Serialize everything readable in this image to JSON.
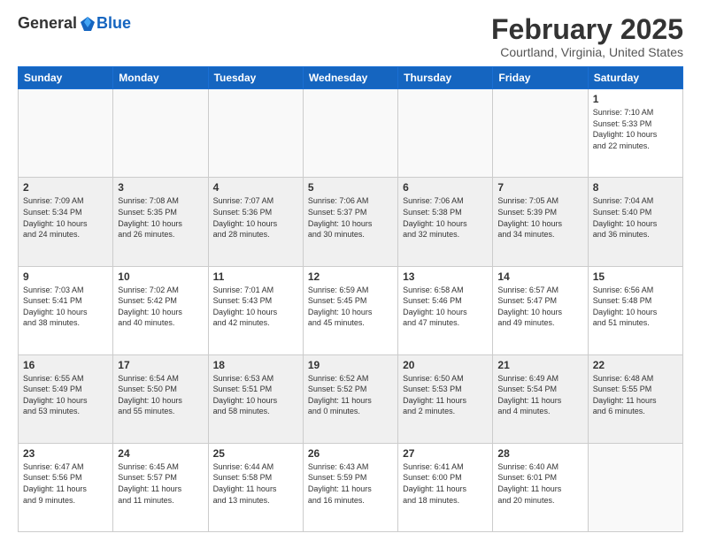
{
  "header": {
    "logo_general": "General",
    "logo_blue": "Blue",
    "month": "February 2025",
    "location": "Courtland, Virginia, United States"
  },
  "weekdays": [
    "Sunday",
    "Monday",
    "Tuesday",
    "Wednesday",
    "Thursday",
    "Friday",
    "Saturday"
  ],
  "weeks": [
    [
      {
        "day": "",
        "info": ""
      },
      {
        "day": "",
        "info": ""
      },
      {
        "day": "",
        "info": ""
      },
      {
        "day": "",
        "info": ""
      },
      {
        "day": "",
        "info": ""
      },
      {
        "day": "",
        "info": ""
      },
      {
        "day": "1",
        "info": "Sunrise: 7:10 AM\nSunset: 5:33 PM\nDaylight: 10 hours\nand 22 minutes."
      }
    ],
    [
      {
        "day": "2",
        "info": "Sunrise: 7:09 AM\nSunset: 5:34 PM\nDaylight: 10 hours\nand 24 minutes."
      },
      {
        "day": "3",
        "info": "Sunrise: 7:08 AM\nSunset: 5:35 PM\nDaylight: 10 hours\nand 26 minutes."
      },
      {
        "day": "4",
        "info": "Sunrise: 7:07 AM\nSunset: 5:36 PM\nDaylight: 10 hours\nand 28 minutes."
      },
      {
        "day": "5",
        "info": "Sunrise: 7:06 AM\nSunset: 5:37 PM\nDaylight: 10 hours\nand 30 minutes."
      },
      {
        "day": "6",
        "info": "Sunrise: 7:06 AM\nSunset: 5:38 PM\nDaylight: 10 hours\nand 32 minutes."
      },
      {
        "day": "7",
        "info": "Sunrise: 7:05 AM\nSunset: 5:39 PM\nDaylight: 10 hours\nand 34 minutes."
      },
      {
        "day": "8",
        "info": "Sunrise: 7:04 AM\nSunset: 5:40 PM\nDaylight: 10 hours\nand 36 minutes."
      }
    ],
    [
      {
        "day": "9",
        "info": "Sunrise: 7:03 AM\nSunset: 5:41 PM\nDaylight: 10 hours\nand 38 minutes."
      },
      {
        "day": "10",
        "info": "Sunrise: 7:02 AM\nSunset: 5:42 PM\nDaylight: 10 hours\nand 40 minutes."
      },
      {
        "day": "11",
        "info": "Sunrise: 7:01 AM\nSunset: 5:43 PM\nDaylight: 10 hours\nand 42 minutes."
      },
      {
        "day": "12",
        "info": "Sunrise: 6:59 AM\nSunset: 5:45 PM\nDaylight: 10 hours\nand 45 minutes."
      },
      {
        "day": "13",
        "info": "Sunrise: 6:58 AM\nSunset: 5:46 PM\nDaylight: 10 hours\nand 47 minutes."
      },
      {
        "day": "14",
        "info": "Sunrise: 6:57 AM\nSunset: 5:47 PM\nDaylight: 10 hours\nand 49 minutes."
      },
      {
        "day": "15",
        "info": "Sunrise: 6:56 AM\nSunset: 5:48 PM\nDaylight: 10 hours\nand 51 minutes."
      }
    ],
    [
      {
        "day": "16",
        "info": "Sunrise: 6:55 AM\nSunset: 5:49 PM\nDaylight: 10 hours\nand 53 minutes."
      },
      {
        "day": "17",
        "info": "Sunrise: 6:54 AM\nSunset: 5:50 PM\nDaylight: 10 hours\nand 55 minutes."
      },
      {
        "day": "18",
        "info": "Sunrise: 6:53 AM\nSunset: 5:51 PM\nDaylight: 10 hours\nand 58 minutes."
      },
      {
        "day": "19",
        "info": "Sunrise: 6:52 AM\nSunset: 5:52 PM\nDaylight: 11 hours\nand 0 minutes."
      },
      {
        "day": "20",
        "info": "Sunrise: 6:50 AM\nSunset: 5:53 PM\nDaylight: 11 hours\nand 2 minutes."
      },
      {
        "day": "21",
        "info": "Sunrise: 6:49 AM\nSunset: 5:54 PM\nDaylight: 11 hours\nand 4 minutes."
      },
      {
        "day": "22",
        "info": "Sunrise: 6:48 AM\nSunset: 5:55 PM\nDaylight: 11 hours\nand 6 minutes."
      }
    ],
    [
      {
        "day": "23",
        "info": "Sunrise: 6:47 AM\nSunset: 5:56 PM\nDaylight: 11 hours\nand 9 minutes."
      },
      {
        "day": "24",
        "info": "Sunrise: 6:45 AM\nSunset: 5:57 PM\nDaylight: 11 hours\nand 11 minutes."
      },
      {
        "day": "25",
        "info": "Sunrise: 6:44 AM\nSunset: 5:58 PM\nDaylight: 11 hours\nand 13 minutes."
      },
      {
        "day": "26",
        "info": "Sunrise: 6:43 AM\nSunset: 5:59 PM\nDaylight: 11 hours\nand 16 minutes."
      },
      {
        "day": "27",
        "info": "Sunrise: 6:41 AM\nSunset: 6:00 PM\nDaylight: 11 hours\nand 18 minutes."
      },
      {
        "day": "28",
        "info": "Sunrise: 6:40 AM\nSunset: 6:01 PM\nDaylight: 11 hours\nand 20 minutes."
      },
      {
        "day": "",
        "info": ""
      }
    ]
  ]
}
